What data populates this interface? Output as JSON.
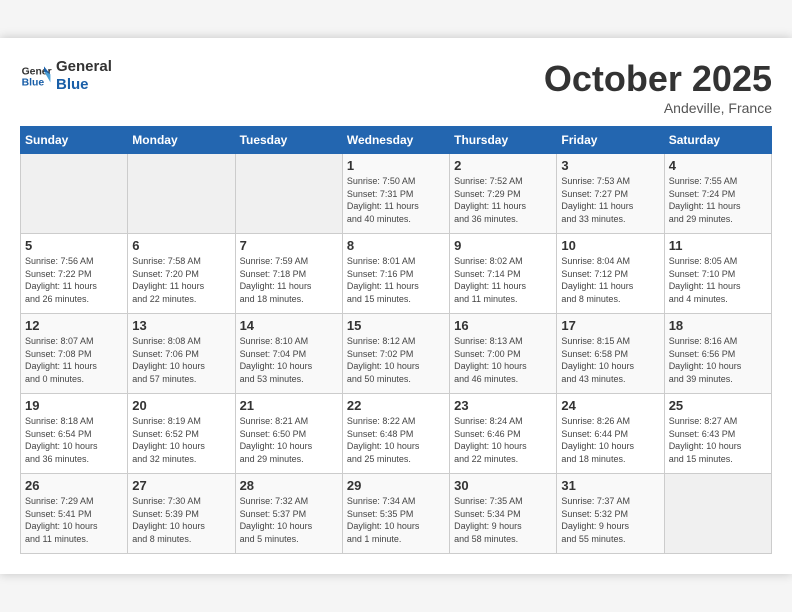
{
  "header": {
    "logo_line1": "General",
    "logo_line2": "Blue",
    "month": "October 2025",
    "location": "Andeville, France"
  },
  "days_of_week": [
    "Sunday",
    "Monday",
    "Tuesday",
    "Wednesday",
    "Thursday",
    "Friday",
    "Saturday"
  ],
  "weeks": [
    [
      {
        "day": "",
        "info": ""
      },
      {
        "day": "",
        "info": ""
      },
      {
        "day": "",
        "info": ""
      },
      {
        "day": "1",
        "info": "Sunrise: 7:50 AM\nSunset: 7:31 PM\nDaylight: 11 hours\nand 40 minutes."
      },
      {
        "day": "2",
        "info": "Sunrise: 7:52 AM\nSunset: 7:29 PM\nDaylight: 11 hours\nand 36 minutes."
      },
      {
        "day": "3",
        "info": "Sunrise: 7:53 AM\nSunset: 7:27 PM\nDaylight: 11 hours\nand 33 minutes."
      },
      {
        "day": "4",
        "info": "Sunrise: 7:55 AM\nSunset: 7:24 PM\nDaylight: 11 hours\nand 29 minutes."
      }
    ],
    [
      {
        "day": "5",
        "info": "Sunrise: 7:56 AM\nSunset: 7:22 PM\nDaylight: 11 hours\nand 26 minutes."
      },
      {
        "day": "6",
        "info": "Sunrise: 7:58 AM\nSunset: 7:20 PM\nDaylight: 11 hours\nand 22 minutes."
      },
      {
        "day": "7",
        "info": "Sunrise: 7:59 AM\nSunset: 7:18 PM\nDaylight: 11 hours\nand 18 minutes."
      },
      {
        "day": "8",
        "info": "Sunrise: 8:01 AM\nSunset: 7:16 PM\nDaylight: 11 hours\nand 15 minutes."
      },
      {
        "day": "9",
        "info": "Sunrise: 8:02 AM\nSunset: 7:14 PM\nDaylight: 11 hours\nand 11 minutes."
      },
      {
        "day": "10",
        "info": "Sunrise: 8:04 AM\nSunset: 7:12 PM\nDaylight: 11 hours\nand 8 minutes."
      },
      {
        "day": "11",
        "info": "Sunrise: 8:05 AM\nSunset: 7:10 PM\nDaylight: 11 hours\nand 4 minutes."
      }
    ],
    [
      {
        "day": "12",
        "info": "Sunrise: 8:07 AM\nSunset: 7:08 PM\nDaylight: 11 hours\nand 0 minutes."
      },
      {
        "day": "13",
        "info": "Sunrise: 8:08 AM\nSunset: 7:06 PM\nDaylight: 10 hours\nand 57 minutes."
      },
      {
        "day": "14",
        "info": "Sunrise: 8:10 AM\nSunset: 7:04 PM\nDaylight: 10 hours\nand 53 minutes."
      },
      {
        "day": "15",
        "info": "Sunrise: 8:12 AM\nSunset: 7:02 PM\nDaylight: 10 hours\nand 50 minutes."
      },
      {
        "day": "16",
        "info": "Sunrise: 8:13 AM\nSunset: 7:00 PM\nDaylight: 10 hours\nand 46 minutes."
      },
      {
        "day": "17",
        "info": "Sunrise: 8:15 AM\nSunset: 6:58 PM\nDaylight: 10 hours\nand 43 minutes."
      },
      {
        "day": "18",
        "info": "Sunrise: 8:16 AM\nSunset: 6:56 PM\nDaylight: 10 hours\nand 39 minutes."
      }
    ],
    [
      {
        "day": "19",
        "info": "Sunrise: 8:18 AM\nSunset: 6:54 PM\nDaylight: 10 hours\nand 36 minutes."
      },
      {
        "day": "20",
        "info": "Sunrise: 8:19 AM\nSunset: 6:52 PM\nDaylight: 10 hours\nand 32 minutes."
      },
      {
        "day": "21",
        "info": "Sunrise: 8:21 AM\nSunset: 6:50 PM\nDaylight: 10 hours\nand 29 minutes."
      },
      {
        "day": "22",
        "info": "Sunrise: 8:22 AM\nSunset: 6:48 PM\nDaylight: 10 hours\nand 25 minutes."
      },
      {
        "day": "23",
        "info": "Sunrise: 8:24 AM\nSunset: 6:46 PM\nDaylight: 10 hours\nand 22 minutes."
      },
      {
        "day": "24",
        "info": "Sunrise: 8:26 AM\nSunset: 6:44 PM\nDaylight: 10 hours\nand 18 minutes."
      },
      {
        "day": "25",
        "info": "Sunrise: 8:27 AM\nSunset: 6:43 PM\nDaylight: 10 hours\nand 15 minutes."
      }
    ],
    [
      {
        "day": "26",
        "info": "Sunrise: 7:29 AM\nSunset: 5:41 PM\nDaylight: 10 hours\nand 11 minutes."
      },
      {
        "day": "27",
        "info": "Sunrise: 7:30 AM\nSunset: 5:39 PM\nDaylight: 10 hours\nand 8 minutes."
      },
      {
        "day": "28",
        "info": "Sunrise: 7:32 AM\nSunset: 5:37 PM\nDaylight: 10 hours\nand 5 minutes."
      },
      {
        "day": "29",
        "info": "Sunrise: 7:34 AM\nSunset: 5:35 PM\nDaylight: 10 hours\nand 1 minute."
      },
      {
        "day": "30",
        "info": "Sunrise: 7:35 AM\nSunset: 5:34 PM\nDaylight: 9 hours\nand 58 minutes."
      },
      {
        "day": "31",
        "info": "Sunrise: 7:37 AM\nSunset: 5:32 PM\nDaylight: 9 hours\nand 55 minutes."
      },
      {
        "day": "",
        "info": ""
      }
    ]
  ]
}
